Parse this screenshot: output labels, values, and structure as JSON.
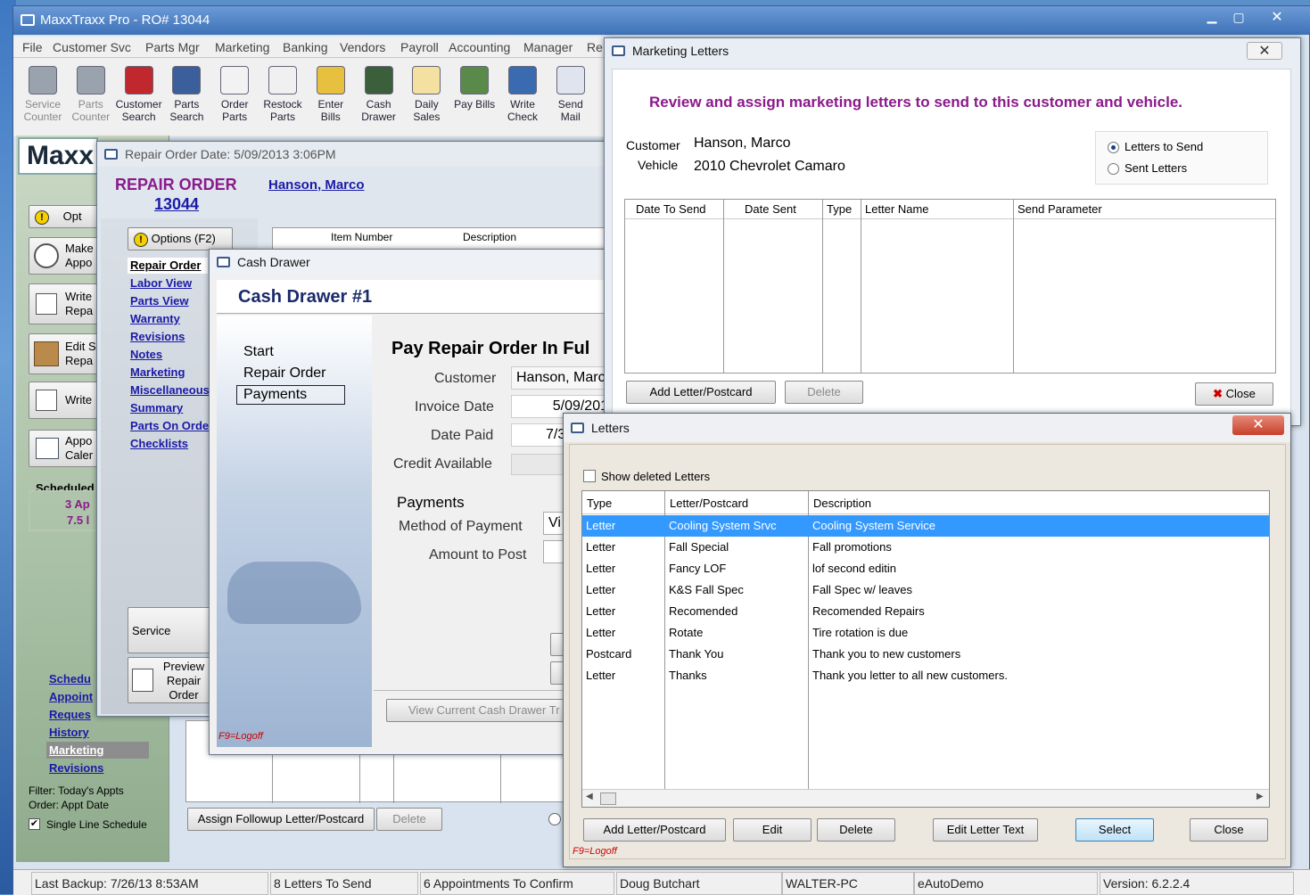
{
  "main_window": {
    "title": "MaxxTraxx Pro - RO# 13044"
  },
  "menu": [
    "File",
    "Customer Svc",
    "Parts Mgr",
    "Marketing",
    "Banking",
    "Vendors",
    "Payroll",
    "Accounting",
    "Manager",
    "Re"
  ],
  "toolbar": [
    {
      "line1": "Service",
      "line2": "Counter",
      "icon": "service-counter-icon",
      "enabled": false
    },
    {
      "line1": "Parts",
      "line2": "Counter",
      "icon": "parts-counter-icon",
      "enabled": false
    },
    {
      "line1": "Customer",
      "line2": "Search",
      "icon": "car-icon",
      "enabled": true
    },
    {
      "line1": "Parts",
      "line2": "Search",
      "icon": "gear-icon",
      "enabled": true
    },
    {
      "line1": "Order",
      "line2": "Parts",
      "icon": "order-parts-icon",
      "enabled": true
    },
    {
      "line1": "Restock",
      "line2": "Parts",
      "icon": "restock-icon",
      "enabled": true
    },
    {
      "line1": "Enter",
      "line2": "Bills",
      "icon": "enter-bills-icon",
      "enabled": true
    },
    {
      "line1": "Cash",
      "line2": "Drawer",
      "icon": "money-bag-icon",
      "enabled": true
    },
    {
      "line1": "Daily",
      "line2": "Sales",
      "icon": "daily-sales-icon",
      "enabled": true
    },
    {
      "line1": "Pay Bills",
      "line2": "",
      "icon": "pay-bills-icon",
      "enabled": true
    },
    {
      "line1": "Write",
      "line2": "Check",
      "icon": "write-check-icon",
      "enabled": true
    },
    {
      "line1": "Send",
      "line2": "Mail",
      "icon": "send-mail-icon",
      "enabled": true
    }
  ],
  "sidebar": {
    "brand": "Maxx",
    "buttons": [
      {
        "label1": "Opt",
        "label2": ""
      },
      {
        "label1": "Make",
        "label2": "Appo"
      },
      {
        "label1": "Write",
        "label2": "Repa"
      },
      {
        "label1": "Edit S",
        "label2": "Repa"
      },
      {
        "label1": "Write",
        "label2": ""
      },
      {
        "label1": "Appo",
        "label2": "Caler"
      }
    ],
    "scheduled_title": "Scheduled",
    "scheduled_line1": "3 Ap",
    "scheduled_line2": "7.5 l",
    "links": [
      "Schedu",
      "Appoint",
      "Reques",
      "History",
      "Marketing",
      "Revisions"
    ],
    "filter": "Filter: Today's Appts",
    "order": "Order: Appt Date",
    "single_line": "Single Line Schedule"
  },
  "repair_order": {
    "title": "Repair Order Date:  5/09/2013   3:06PM",
    "heading": "REPAIR ORDER",
    "number": "13044",
    "customer_link": "Hanson, Marco",
    "options_btn": "Options (F2)",
    "nav": [
      "Repair Order",
      "Labor View",
      "Parts View",
      "Warranty",
      "Revisions",
      "Notes",
      "Marketing",
      "Miscellaneous",
      "Summary",
      "Parts On Order",
      "Checklists"
    ],
    "grid_headers": [
      "Item Number",
      "Description"
    ],
    "service_btn": "Service Intellige",
    "preview_btn": [
      "Preview",
      "Repair",
      "Order"
    ],
    "assign_btn": "Assign Followup Letter/Postcard",
    "delete_btn": "Delete"
  },
  "cash_drawer": {
    "title": "Cash Drawer",
    "heading": "Cash Drawer #1",
    "nav": [
      "Start",
      "Repair Order",
      "Payments"
    ],
    "pay_title": "Pay Repair Order In Ful",
    "fields": [
      {
        "label": "Customer",
        "value": "Hanson, Marc"
      },
      {
        "label": "Invoice Date",
        "value": "5/09/201"
      },
      {
        "label": "Date Paid",
        "value": "7/3"
      },
      {
        "label": "Credit Available",
        "value": ""
      }
    ],
    "payments_label": "Payments",
    "method_label": "Method of Payment",
    "method_value": "Vi",
    "amount_label": "Amount to Post",
    "view_btn": "View Current Cash Drawer Tr",
    "logoff": "F9=Logoff"
  },
  "marketing": {
    "title": "Marketing Letters",
    "heading": "Review and assign marketing letters to send to this customer and vehicle.",
    "customer_label": "Customer",
    "customer_value": "Hanson, Marco",
    "vehicle_label": "Vehicle",
    "vehicle_value": "2010 Chevrolet Camaro",
    "radio_send": "Letters to Send",
    "radio_sent": "Sent Letters",
    "columns": [
      "Date To Send",
      "Date Sent",
      "Type",
      "Letter Name",
      "Send Parameter"
    ],
    "add_btn": "Add Letter/Postcard",
    "delete_btn": "Delete",
    "close_btn": "Close"
  },
  "letters": {
    "title": "Letters",
    "show_deleted": "Show deleted Letters",
    "columns": [
      "Type",
      "Letter/Postcard",
      "Description"
    ],
    "rows": [
      {
        "type": "Letter",
        "name": "Cooling System Srvc",
        "desc": "Cooling System Service"
      },
      {
        "type": "Letter",
        "name": "Fall Special",
        "desc": "Fall promotions"
      },
      {
        "type": "Letter",
        "name": "Fancy LOF",
        "desc": "lof second editin"
      },
      {
        "type": "Letter",
        "name": "K&S Fall Spec",
        "desc": "Fall Spec w/ leaves"
      },
      {
        "type": "Letter",
        "name": "Recomended",
        "desc": "Recomended Repairs"
      },
      {
        "type": "Letter",
        "name": "Rotate",
        "desc": "Tire rotation is due"
      },
      {
        "type": "Postcard",
        "name": "Thank You",
        "desc": "Thank you to new customers"
      },
      {
        "type": "Letter",
        "name": "Thanks",
        "desc": "Thank you letter to all new customers."
      }
    ],
    "buttons": {
      "add": "Add Letter/Postcard",
      "edit": "Edit",
      "delete": "Delete",
      "edit_text": "Edit Letter Text",
      "select": "Select",
      "close": "Close"
    },
    "logoff": "F9=Logoff"
  },
  "status_bar": [
    "Last Backup:  7/26/13   8:53AM",
    "8 Letters To Send",
    "6 Appointments To Confirm",
    "Doug Butchart",
    "WALTER-PC",
    "eAutoDemo",
    "Version:  6.2.2.4"
  ],
  "colors": {
    "accent_purple": "#8b1a8b",
    "link_blue": "#1a1aa8",
    "selection": "#3399ff",
    "navy": "#1a2a6b"
  }
}
